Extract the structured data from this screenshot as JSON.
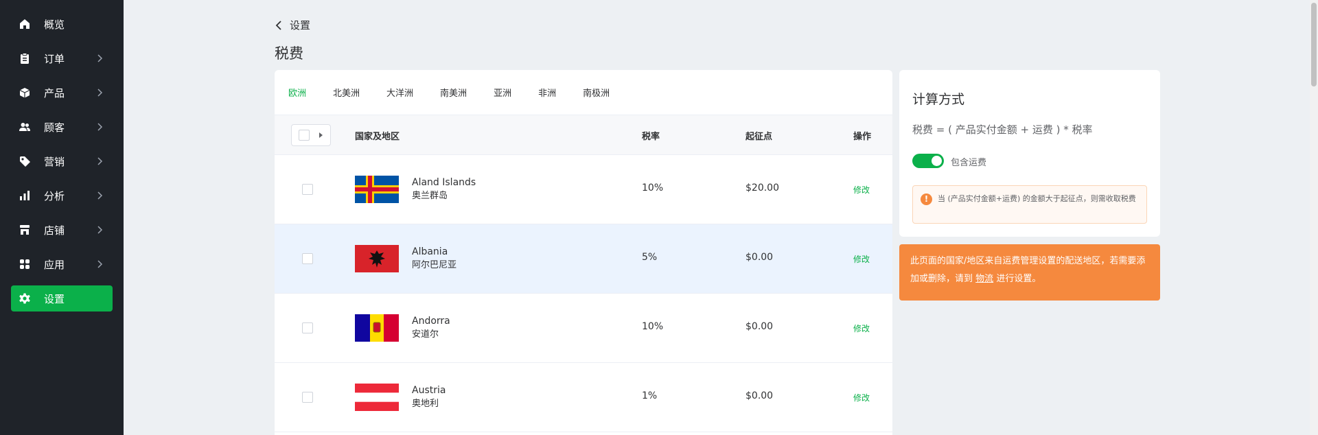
{
  "sidebar": {
    "items": [
      {
        "label": "概览",
        "icon": "home-icon",
        "has_arrow": false,
        "active": false
      },
      {
        "label": "订单",
        "icon": "clipboard-icon",
        "has_arrow": true,
        "active": false
      },
      {
        "label": "产品",
        "icon": "box-icon",
        "has_arrow": true,
        "active": false
      },
      {
        "label": "顾客",
        "icon": "users-icon",
        "has_arrow": true,
        "active": false
      },
      {
        "label": "营销",
        "icon": "tag-icon",
        "has_arrow": true,
        "active": false
      },
      {
        "label": "分析",
        "icon": "bar-chart-icon",
        "has_arrow": true,
        "active": false
      },
      {
        "label": "店铺",
        "icon": "store-icon",
        "has_arrow": true,
        "active": false
      },
      {
        "label": "应用",
        "icon": "apps-icon",
        "has_arrow": true,
        "active": false
      },
      {
        "label": "设置",
        "icon": "gear-icon",
        "has_arrow": false,
        "active": true
      }
    ]
  },
  "header": {
    "back_label": "设置",
    "title": "税费"
  },
  "tabs": [
    {
      "label": "欧洲",
      "active": true
    },
    {
      "label": "北美洲",
      "active": false
    },
    {
      "label": "大洋洲",
      "active": false
    },
    {
      "label": "南美洲",
      "active": false
    },
    {
      "label": "亚洲",
      "active": false
    },
    {
      "label": "非洲",
      "active": false
    },
    {
      "label": "南极洲",
      "active": false
    }
  ],
  "table": {
    "headers": {
      "country": "国家及地区",
      "rate": "税率",
      "threshold": "起征点",
      "action": "操作"
    },
    "rows": [
      {
        "name_en": "Aland Islands",
        "name_zh": "奥兰群岛",
        "rate": "10%",
        "threshold": "$20.00",
        "action": "修改",
        "flag": "aland-flag-icon",
        "highlighted": false
      },
      {
        "name_en": "Albania",
        "name_zh": "阿尔巴尼亚",
        "rate": "5%",
        "threshold": "$0.00",
        "action": "修改",
        "flag": "albania-flag-icon",
        "highlighted": true
      },
      {
        "name_en": "Andorra",
        "name_zh": "安道尔",
        "rate": "10%",
        "threshold": "$0.00",
        "action": "修改",
        "flag": "andorra-flag-icon",
        "highlighted": false
      },
      {
        "name_en": "Austria",
        "name_zh": "奥地利",
        "rate": "1%",
        "threshold": "$0.00",
        "action": "修改",
        "flag": "austria-flag-icon",
        "highlighted": false
      }
    ]
  },
  "calc": {
    "title": "计算方式",
    "formula": "税费 = ( 产品实付金额 + 运费 ) * 税率",
    "toggle_label": "包含运费",
    "toggle_on": true,
    "warning": "当 (产品实付金额+运费) 的金额大于起征点，则需收取税费"
  },
  "notice": {
    "text_before": "此页面的国家/地区来自运费管理设置的配送地区，若需要添加或删除，请到",
    "link": "物流",
    "text_after": "进行设置。"
  },
  "colors": {
    "accent": "#0bb04a",
    "sidebar_bg": "#1f2329",
    "notice_bg": "#f5893e",
    "row_highlight": "#ebf3fe"
  }
}
